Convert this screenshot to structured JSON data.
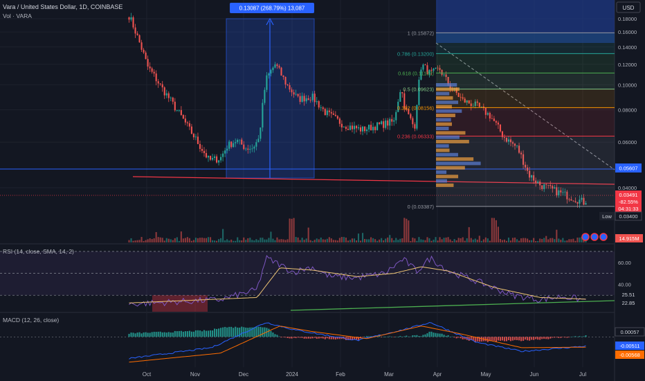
{
  "header": {
    "symbol_line": "Vara / United States Dollar, 1D, COINBASE",
    "vol_line": "Vol · VARA",
    "currency_button": "USD"
  },
  "colors": {
    "background": "#131722",
    "up": "#26a69a",
    "down": "#ef5350",
    "grid": "#1e222d",
    "axis_text": "#b2b5be",
    "rsi_line": "#7e57c2",
    "rsi_ma": "#f0c674",
    "macd_line": "#2962ff",
    "signal_line": "#ff6d00",
    "blue_hline": "#2962ff",
    "red_trend": "#f23645",
    "green_trend": "#4caf50",
    "measure_box": "#1e3a8a"
  },
  "chart_data": [
    {
      "type": "candlestick",
      "name": "VARA/USD price",
      "y_scale": "log",
      "ylim": [
        0.03,
        0.19
      ],
      "x_ticks": [
        "Oct",
        "Nov",
        "Dec",
        "2024",
        "Feb",
        "Mar",
        "Apr",
        "May",
        "Jun",
        "Jul"
      ],
      "y_ticks": [
        "0.18000",
        "0.16000",
        "0.14000",
        "0.12000",
        "0.10000",
        "0.08000",
        "0.06000",
        "0.04000"
      ],
      "anchors": [
        {
          "t": 0.0,
          "v": 0.185
        },
        {
          "t": 0.02,
          "v": 0.15
        },
        {
          "t": 0.04,
          "v": 0.118
        },
        {
          "t": 0.07,
          "v": 0.098
        },
        {
          "t": 0.1,
          "v": 0.082
        },
        {
          "t": 0.13,
          "v": 0.068
        },
        {
          "t": 0.155,
          "v": 0.058
        },
        {
          "t": 0.175,
          "v": 0.051
        },
        {
          "t": 0.2,
          "v": 0.052
        },
        {
          "t": 0.215,
          "v": 0.058
        },
        {
          "t": 0.235,
          "v": 0.061
        },
        {
          "t": 0.255,
          "v": 0.057
        },
        {
          "t": 0.27,
          "v": 0.057
        },
        {
          "t": 0.285,
          "v": 0.062
        },
        {
          "t": 0.3,
          "v": 0.105
        },
        {
          "t": 0.32,
          "v": 0.12
        },
        {
          "t": 0.345,
          "v": 0.1
        },
        {
          "t": 0.37,
          "v": 0.088
        },
        {
          "t": 0.4,
          "v": 0.09
        },
        {
          "t": 0.43,
          "v": 0.078
        },
        {
          "t": 0.47,
          "v": 0.07
        },
        {
          "t": 0.51,
          "v": 0.067
        },
        {
          "t": 0.55,
          "v": 0.07
        },
        {
          "t": 0.58,
          "v": 0.072
        },
        {
          "t": 0.595,
          "v": 0.098
        },
        {
          "t": 0.605,
          "v": 0.08
        },
        {
          "t": 0.625,
          "v": 0.068
        },
        {
          "t": 0.64,
          "v": 0.12
        },
        {
          "t": 0.66,
          "v": 0.11
        },
        {
          "t": 0.68,
          "v": 0.115
        },
        {
          "t": 0.7,
          "v": 0.1
        },
        {
          "t": 0.73,
          "v": 0.087
        },
        {
          "t": 0.76,
          "v": 0.083
        },
        {
          "t": 0.79,
          "v": 0.076
        },
        {
          "t": 0.82,
          "v": 0.063
        },
        {
          "t": 0.85,
          "v": 0.057
        },
        {
          "t": 0.875,
          "v": 0.045
        },
        {
          "t": 0.9,
          "v": 0.041
        },
        {
          "t": 0.93,
          "v": 0.039
        },
        {
          "t": 1.0,
          "v": 0.0349
        }
      ]
    },
    {
      "type": "line",
      "name": "RSI (14, close, SMA, 14, 2)",
      "ylim": [
        15,
        75
      ],
      "y_ticks": [
        "60.00",
        "40.00"
      ],
      "rsi_anchors": [
        {
          "t": 0.0,
          "v": 22
        },
        {
          "t": 0.2,
          "v": 26
        },
        {
          "t": 0.28,
          "v": 35
        },
        {
          "t": 0.3,
          "v": 64
        },
        {
          "t": 0.33,
          "v": 58
        },
        {
          "t": 0.36,
          "v": 51
        },
        {
          "t": 0.4,
          "v": 56
        },
        {
          "t": 0.44,
          "v": 47
        },
        {
          "t": 0.5,
          "v": 46
        },
        {
          "t": 0.56,
          "v": 50
        },
        {
          "t": 0.6,
          "v": 63
        },
        {
          "t": 0.63,
          "v": 52
        },
        {
          "t": 0.66,
          "v": 64
        },
        {
          "t": 0.7,
          "v": 52
        },
        {
          "t": 0.76,
          "v": 43
        },
        {
          "t": 0.84,
          "v": 30
        },
        {
          "t": 0.9,
          "v": 26
        },
        {
          "t": 0.95,
          "v": 29
        },
        {
          "t": 1.0,
          "v": 25.5
        }
      ],
      "ma_anchors": [
        {
          "t": 0.0,
          "v": 23
        },
        {
          "t": 0.28,
          "v": 28
        },
        {
          "t": 0.33,
          "v": 55
        },
        {
          "t": 0.4,
          "v": 53
        },
        {
          "t": 0.5,
          "v": 47
        },
        {
          "t": 0.58,
          "v": 50
        },
        {
          "t": 0.64,
          "v": 56
        },
        {
          "t": 0.7,
          "v": 52
        },
        {
          "t": 0.8,
          "v": 37
        },
        {
          "t": 0.9,
          "v": 28
        },
        {
          "t": 1.0,
          "v": 26.5
        }
      ],
      "current_rsi": "25.51",
      "current_other": "22.85"
    },
    {
      "type": "bar",
      "name": "MACD (12, 26, close)",
      "macd_anchors": [
        {
          "t": 0.0,
          "v": -0.012
        },
        {
          "t": 0.18,
          "v": -0.006
        },
        {
          "t": 0.3,
          "v": 0.008
        },
        {
          "t": 0.36,
          "v": 0.004
        },
        {
          "t": 0.5,
          "v": -0.002
        },
        {
          "t": 0.6,
          "v": 0.004
        },
        {
          "t": 0.66,
          "v": 0.008
        },
        {
          "t": 0.76,
          "v": -0.003
        },
        {
          "t": 0.86,
          "v": -0.008
        },
        {
          "t": 1.0,
          "v": -0.0051
        }
      ],
      "signal_anchors": [
        {
          "t": 0.0,
          "v": -0.014
        },
        {
          "t": 0.2,
          "v": -0.009
        },
        {
          "t": 0.33,
          "v": 0.006
        },
        {
          "t": 0.4,
          "v": 0.003
        },
        {
          "t": 0.52,
          "v": -0.001
        },
        {
          "t": 0.64,
          "v": 0.006
        },
        {
          "t": 0.72,
          "v": 0.002
        },
        {
          "t": 0.86,
          "v": -0.006
        },
        {
          "t": 1.0,
          "v": -0.0057
        }
      ],
      "ylim": [
        -0.016,
        0.012
      ],
      "hist_value": "0.00057",
      "macd_value": "-0.00511",
      "signal_value": "-0.00568"
    }
  ],
  "fib_levels": [
    {
      "label": "1 (0.15872)",
      "value": 0.15872,
      "color": "#9598a1"
    },
    {
      "label": "0.786 (0.13200)",
      "value": 0.132,
      "color": "#26a69a"
    },
    {
      "label": "0.618 (0.11102)",
      "value": 0.11102,
      "color": "#4caf50"
    },
    {
      "label": "0.5 (0.09623)",
      "value": 0.09623,
      "color": "#81c784"
    },
    {
      "label": "0.382 (0.08156)",
      "value": 0.08156,
      "color": "#ff9800"
    },
    {
      "label": "0.236 (0.06333)",
      "value": 0.06333,
      "color": "#f23645"
    },
    {
      "label": "0 (0.03387)",
      "value": 0.03387,
      "color": "#9598a1"
    }
  ],
  "measure_label": "0.13087 (268.79%) 13,087",
  "price_tags": {
    "hline": "0.05607",
    "last_price": "0.03491",
    "change": "-82.55%",
    "countdown": "04:31:33",
    "low_label": "Low",
    "low_value": "0.03400",
    "volume": "14.915M"
  }
}
